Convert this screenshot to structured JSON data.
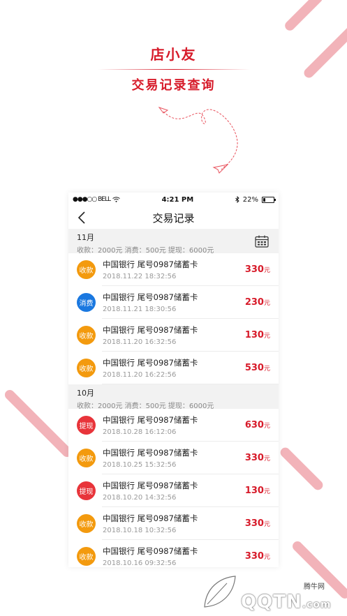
{
  "promo": {
    "title": "店小友",
    "subtitle": "交易记录查询"
  },
  "status_bar": {
    "carrier": "●●●○○ BELL",
    "time": "4:21 PM",
    "battery": "22%"
  },
  "nav": {
    "title": "交易记录"
  },
  "months": [
    {
      "label": "11月",
      "summary": "收款：2000元  消费：500元  提现：6000元",
      "transactions": [
        {
          "type": "收款",
          "type_color": "#f39a0e",
          "name": "中国银行 尾号0987储蓄卡",
          "time": "2018.11.22 18:32:56",
          "amount": "330",
          "unit": "元"
        },
        {
          "type": "消费",
          "type_color": "#1a78e0",
          "name": "中国银行 尾号0987储蓄卡",
          "time": "2018.11.21 18:30:56",
          "amount": "230",
          "unit": "元"
        },
        {
          "type": "收款",
          "type_color": "#f39a0e",
          "name": "中国银行 尾号0987储蓄卡",
          "time": "2018.11.20 16:32:56",
          "amount": "130",
          "unit": "元"
        },
        {
          "type": "收款",
          "type_color": "#f39a0e",
          "name": "中国银行 尾号0987储蓄卡",
          "time": "2018.11.20 16:22:56",
          "amount": "530",
          "unit": "元"
        }
      ]
    },
    {
      "label": "10月",
      "summary": "收款：2000元  消费：500元  提现：6000元",
      "transactions": [
        {
          "type": "提现",
          "type_color": "#e8343a",
          "name": "中国银行 尾号0987储蓄卡",
          "time": "2018.10.28 16:12:06",
          "amount": "630",
          "unit": "元"
        },
        {
          "type": "收款",
          "type_color": "#f39a0e",
          "name": "中国银行 尾号0987储蓄卡",
          "time": "2018.10.25 15:32:56",
          "amount": "330",
          "unit": "元"
        },
        {
          "type": "提现",
          "type_color": "#e8343a",
          "name": "中国银行 尾号0987储蓄卡",
          "time": "2018.10.20 14:32:56",
          "amount": "130",
          "unit": "元"
        },
        {
          "type": "收款",
          "type_color": "#f39a0e",
          "name": "中国银行 尾号0987储蓄卡",
          "time": "2018.10.18 10:32:56",
          "amount": "330",
          "unit": "元"
        },
        {
          "type": "收款",
          "type_color": "#f39a0e",
          "name": "中国银行 尾号0987储蓄卡",
          "time": "2018.10.16 09:32:56",
          "amount": "330",
          "unit": "元"
        }
      ]
    }
  ],
  "watermark": {
    "cn": "腾牛网",
    "brand": "QQTN",
    "suffix": ".com"
  }
}
